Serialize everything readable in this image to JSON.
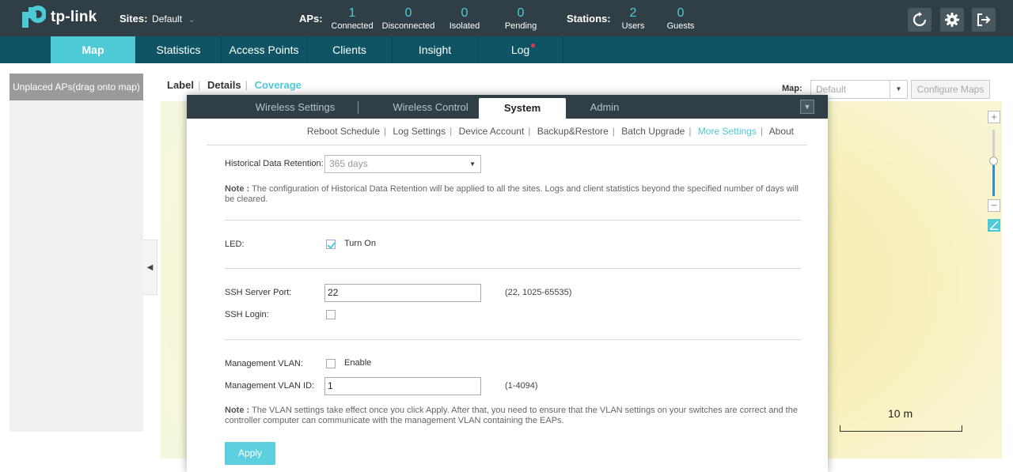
{
  "header": {
    "logo_text": "tp-link",
    "sites_label": "Sites:",
    "sites_value": "Default",
    "aps_label": "APs:",
    "aps": [
      {
        "num": "1",
        "label": "Connected"
      },
      {
        "num": "0",
        "label": "Disconnected"
      },
      {
        "num": "0",
        "label": "Isolated"
      },
      {
        "num": "0",
        "label": "Pending"
      }
    ],
    "stations_label": "Stations:",
    "stations": [
      {
        "num": "2",
        "label": "Users"
      },
      {
        "num": "0",
        "label": "Guests"
      }
    ],
    "accent_color": "#4ec9d6"
  },
  "nav": {
    "items": [
      "Map",
      "Statistics",
      "Access Points",
      "Clients",
      "Insight",
      "Log"
    ],
    "active": "Map",
    "log_has_alert": true
  },
  "left_panel": {
    "unplaced_label": "Unplaced APs(drag onto map)"
  },
  "map": {
    "view_tabs": [
      "Label",
      "Details",
      "Coverage"
    ],
    "active_view": "Coverage",
    "map_label": "Map:",
    "map_select_value": "Default",
    "configure_maps_label": "Configure Maps",
    "scale_label": "10 m",
    "zoom_level": 0.55
  },
  "modal": {
    "tabs": [
      "Wireless Settings",
      "Wireless Control",
      "System",
      "Admin"
    ],
    "active_tab": "System",
    "subnav": [
      "Reboot Schedule",
      "Log Settings",
      "Device Account",
      "Backup&Restore",
      "Batch Upgrade",
      "More Settings",
      "About"
    ],
    "active_subnav": "More Settings",
    "retention": {
      "label": "Historical Data Retention:",
      "value": "365 days",
      "note_bold": "Note :",
      "note_text": " The configuration of Historical Data Retention will be applied to all the sites. Logs and client statistics beyond the specified number of days will be cleared."
    },
    "led": {
      "label": "LED:",
      "checkbox_label": "Turn On",
      "checked": true
    },
    "ssh": {
      "port_label": "SSH Server Port:",
      "port_value": "22",
      "port_range": "(22, 1025-65535)",
      "login_label": "SSH Login:",
      "login_checked": false
    },
    "vlan": {
      "label": "Management VLAN:",
      "enable_label": "Enable",
      "enabled": false,
      "id_label": "Management VLAN ID:",
      "id_value": "1",
      "id_range": "(1-4094)",
      "note_bold": "Note :",
      "note_text": " The VLAN settings take effect once you click Apply. After that, you need to ensure that the VLAN settings on your switches are correct and the controller computer can communicate with the management VLAN containing the EAPs."
    },
    "apply_label": "Apply"
  }
}
